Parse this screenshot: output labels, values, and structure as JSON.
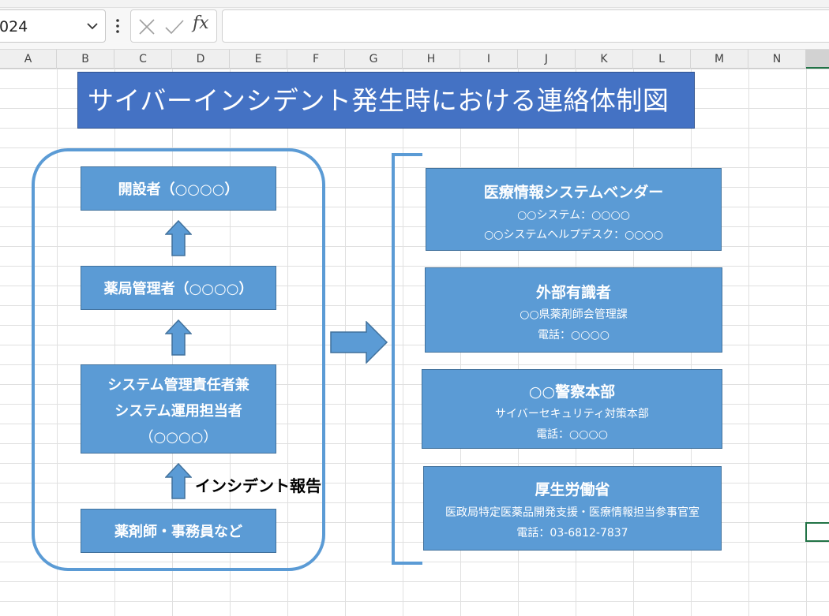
{
  "formula_bar": {
    "name_box": "024",
    "fx_label": "fx",
    "content": ""
  },
  "columns": [
    "A",
    "B",
    "C",
    "D",
    "E",
    "F",
    "G",
    "H",
    "I",
    "J",
    "K",
    "L",
    "M",
    "N"
  ],
  "diagram": {
    "title": "サイバーインシデント発生時における連絡体制図",
    "left_chain": {
      "box1": "開設者（○○○○）",
      "box2": "薬局管理者（○○○○）",
      "box3_line1": "システム管理責任者兼",
      "box3_line2": "システム運用担当者",
      "box3_line3": "（○○○○）",
      "box4": "薬剤師・事務員など",
      "report_label": "インシデント報告"
    },
    "contacts": [
      {
        "name": "医療情報システムベンダー",
        "line1": "○○システム：○○○○",
        "line2": "○○システムヘルプデスク：○○○○"
      },
      {
        "name": "外部有識者",
        "line1": "○○県薬剤師会管理課",
        "line2": "電話：○○○○"
      },
      {
        "name": "○○警察本部",
        "line1": "サイバーセキュリティ対策本部",
        "line2": "電話：○○○○"
      },
      {
        "name": "厚生労働省",
        "line1": "医政局特定医薬品開発支援・医療情報担当参事官室",
        "line2": "電話：03-6812-7837"
      }
    ]
  },
  "colors": {
    "title_fill": "#4472c4",
    "box_fill": "#5b9bd5",
    "box_border": "#41719c",
    "grid_line": "#e0e0e0",
    "selection": "#217346"
  },
  "icons": [
    "chevron-down-icon",
    "more-options-icon",
    "cancel-icon",
    "enter-icon",
    "function-icon",
    "up-arrow-icon",
    "right-arrow-icon"
  ]
}
